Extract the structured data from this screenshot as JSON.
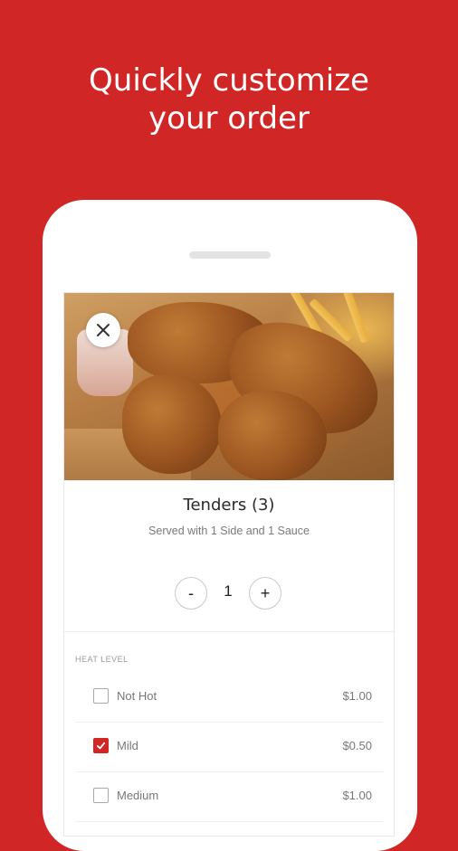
{
  "headline": {
    "line1": "Quickly customize",
    "line2": "your order"
  },
  "colors": {
    "brand_red": "#d12626",
    "checkbox_checked": "#d12626"
  },
  "item": {
    "photo_icon": "close-icon",
    "title": "Tenders (3)",
    "description": "Served with 1 Side and 1 Sauce"
  },
  "quantity": {
    "minus_label": "-",
    "value": "1",
    "plus_label": "+"
  },
  "heat_level": {
    "section_label": "HEAT LEVEL",
    "options": [
      {
        "label": "Not Hot",
        "price": "$1.00",
        "checked": false
      },
      {
        "label": "Mild",
        "price": "$0.50",
        "checked": true
      },
      {
        "label": "Medium",
        "price": "$1.00",
        "checked": false
      }
    ]
  }
}
